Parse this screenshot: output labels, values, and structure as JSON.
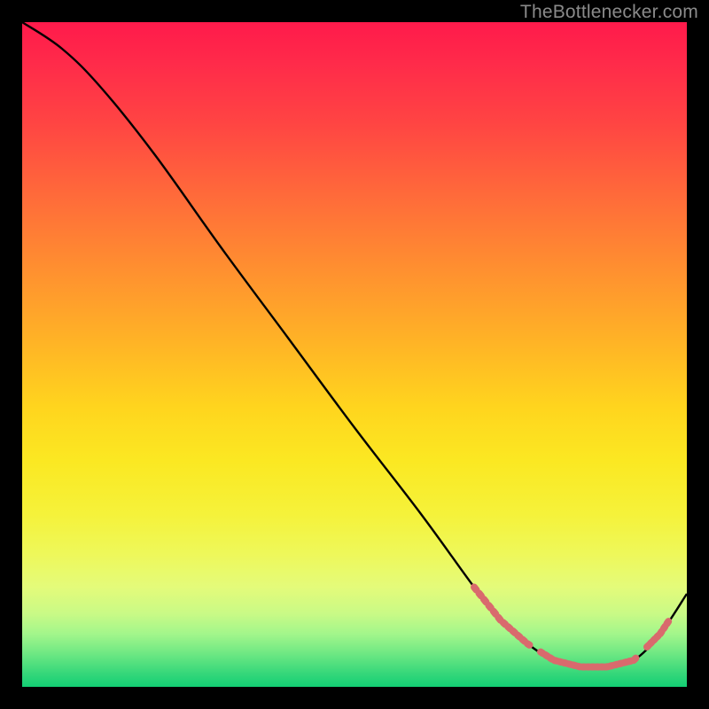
{
  "attribution": "TheBottlenecker.com",
  "chart_data": {
    "type": "line",
    "title": "",
    "xlabel": "",
    "ylabel": "",
    "xlim": [
      0,
      100
    ],
    "ylim": [
      0,
      100
    ],
    "series": [
      {
        "name": "bottleneck-curve",
        "x": [
          0,
          6,
          12,
          20,
          30,
          40,
          50,
          60,
          68,
          72,
          76,
          80,
          84,
          88,
          92,
          96,
          100
        ],
        "y": [
          100,
          96,
          90,
          80,
          66,
          52.5,
          39,
          26,
          15,
          10,
          6.5,
          4,
          3,
          3,
          4,
          8,
          14
        ]
      }
    ],
    "highlight_segments": [
      {
        "x0": 68,
        "x1": 76,
        "note": "descending-near-minimum"
      },
      {
        "x0": 78,
        "x1": 92,
        "note": "flat-minimum"
      },
      {
        "x0": 94,
        "x1": 97,
        "note": "ascending-after-minimum"
      }
    ],
    "colors": {
      "curve": "#000000",
      "highlight": "#d96a6d",
      "background_top": "#ff1a4b",
      "background_bottom": "#13cf74"
    }
  }
}
